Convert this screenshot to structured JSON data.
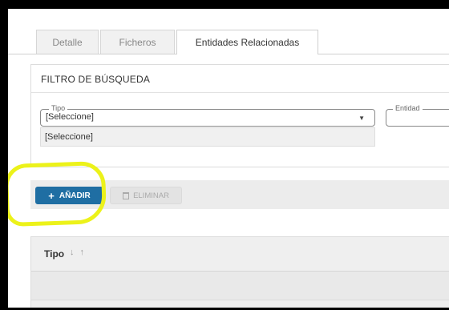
{
  "tabs": [
    {
      "label": "Detalle",
      "active": false
    },
    {
      "label": "Ficheros",
      "active": false
    },
    {
      "label": "Entidades Relacionadas",
      "active": true
    }
  ],
  "filter": {
    "title": "FILTRO DE BÚSQUEDA",
    "tipo": {
      "legend": "Tipo",
      "value": "[Seleccione]",
      "option": "[Seleccione]"
    },
    "entidad": {
      "legend": "Entidad",
      "value": ""
    }
  },
  "toolbar": {
    "add_label": "AÑADIR",
    "add_icon": "plus-icon",
    "delete_label": "ELIMINAR",
    "delete_icon": "trash-icon",
    "add_color": "#1f6ea3",
    "highlight_color": "#ecf21a"
  },
  "table": {
    "columns": [
      {
        "label": "Tipo",
        "sort_icons": "↓ ↑"
      }
    ]
  }
}
